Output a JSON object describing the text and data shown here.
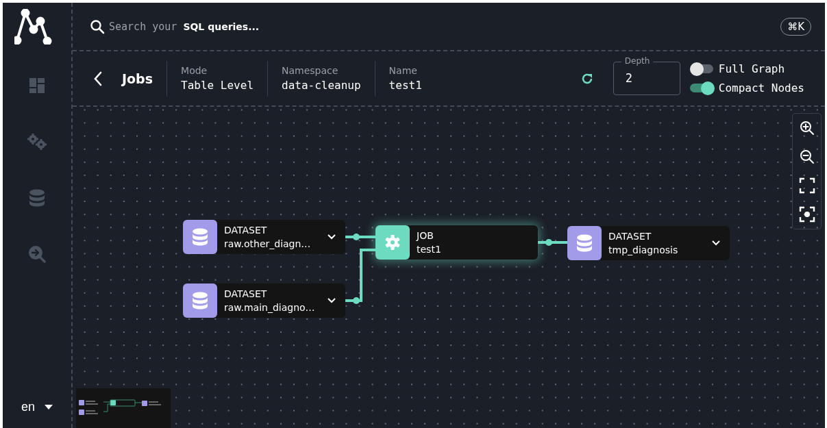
{
  "sidebar": {
    "items": [
      {
        "kind": "dashboard"
      },
      {
        "kind": "jobs"
      },
      {
        "kind": "datasets"
      },
      {
        "kind": "lineage"
      }
    ],
    "language": "en"
  },
  "search": {
    "hint": "Search your **SQL queries...**",
    "shortcut": "⌘K"
  },
  "header": {
    "title": "Jobs",
    "fields": [
      {
        "label": "Mode",
        "value": "Table Level"
      },
      {
        "label": "Namespace",
        "value": "data-cleanup"
      },
      {
        "label": "Name",
        "value": "test1"
      }
    ],
    "depth": {
      "label": "Depth",
      "value": "2"
    },
    "toggles": [
      {
        "label": "Full Graph",
        "on": false
      },
      {
        "label": "Compact Nodes",
        "on": true
      }
    ]
  },
  "graph": {
    "nodes": [
      {
        "kind": "dataset",
        "type_label": "DATASET",
        "name": "raw.other_diagn…",
        "selected": false
      },
      {
        "kind": "dataset",
        "type_label": "DATASET",
        "name": "raw.main_diagno…",
        "selected": false
      },
      {
        "kind": "job",
        "type_label": "JOB",
        "name": "test1",
        "selected": true
      },
      {
        "kind": "dataset",
        "type_label": "DATASET",
        "name": "tmp_diagnosis",
        "selected": false
      }
    ]
  }
}
